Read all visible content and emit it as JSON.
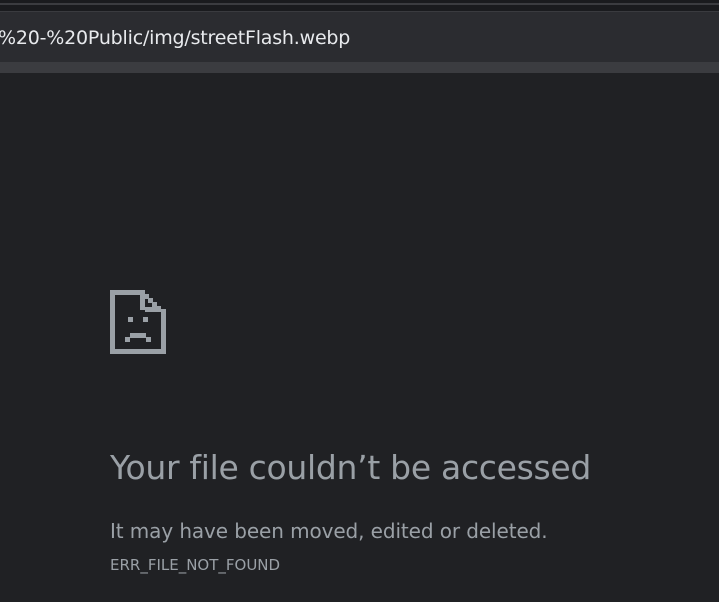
{
  "browser": {
    "address_text": "%20-%20Public/img/streetFlash.webp"
  },
  "error_page": {
    "icon": "sad-file-icon",
    "title": "Your file couldn’t be accessed",
    "message": "It may have been moved, edited or deleted.",
    "error_code": "ERR_FILE_NOT_FOUND"
  },
  "colors": {
    "page_background": "#202124",
    "text_muted": "#9aa0a6",
    "address_text": "#e8eaed"
  }
}
